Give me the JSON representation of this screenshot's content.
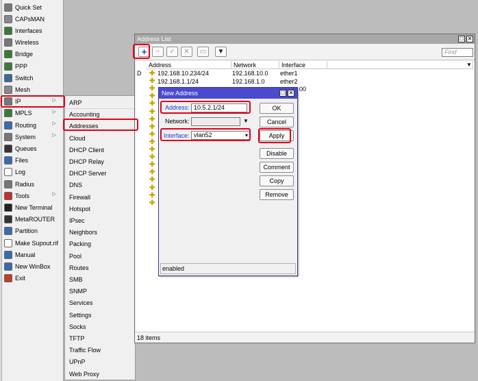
{
  "menu": [
    {
      "label": "Quick Set",
      "icon": "quick-set-icon",
      "color": "#777"
    },
    {
      "label": "CAPsMAN",
      "icon": "capsman-icon",
      "color": "#888"
    },
    {
      "label": "Interfaces",
      "icon": "interfaces-icon",
      "color": "#3a7a3a"
    },
    {
      "label": "Wireless",
      "icon": "wireless-icon",
      "color": "#777"
    },
    {
      "label": "Bridge",
      "icon": "bridge-icon",
      "color": "#3a7a3a"
    },
    {
      "label": "PPP",
      "icon": "ppp-icon",
      "color": "#3a7a3a"
    },
    {
      "label": "Switch",
      "icon": "switch-icon",
      "color": "#3a6a9a"
    },
    {
      "label": "Mesh",
      "icon": "mesh-icon",
      "color": "#888"
    },
    {
      "label": "IP",
      "icon": "ip-icon",
      "color": "#777",
      "arrow": true
    },
    {
      "label": "MPLS",
      "icon": "mpls-icon",
      "color": "#3a7a3a",
      "arrow": true
    },
    {
      "label": "Routing",
      "icon": "routing-icon",
      "color": "#3a6ab0",
      "arrow": true
    },
    {
      "label": "System",
      "icon": "system-icon",
      "color": "#777",
      "arrow": true
    },
    {
      "label": "Queues",
      "icon": "queues-icon",
      "color": "#333"
    },
    {
      "label": "Files",
      "icon": "files-icon",
      "color": "#3a6ab0"
    },
    {
      "label": "Log",
      "icon": "log-icon",
      "color": "#fff"
    },
    {
      "label": "Radius",
      "icon": "radius-icon",
      "color": "#777"
    },
    {
      "label": "Tools",
      "icon": "tools-icon",
      "color": "#c03030",
      "arrow": true
    },
    {
      "label": "New Terminal",
      "icon": "terminal-icon",
      "color": "#222"
    },
    {
      "label": "MetaROUTER",
      "icon": "metarouter-icon",
      "color": "#333"
    },
    {
      "label": "Partition",
      "icon": "partition-icon",
      "color": "#3a6ab0"
    },
    {
      "label": "Make Supout.rif",
      "icon": "supout-icon",
      "color": "#fff"
    },
    {
      "label": "Manual",
      "icon": "manual-icon",
      "color": "#3a6ab0"
    },
    {
      "label": "New WinBox",
      "icon": "winbox-icon",
      "color": "#3a6ab0"
    },
    {
      "label": "Exit",
      "icon": "exit-icon",
      "color": "#c04020"
    }
  ],
  "submenu": [
    "ARP",
    "Accounting",
    "Addresses",
    "Cloud",
    "DHCP Client",
    "DHCP Relay",
    "DHCP Server",
    "DNS",
    "Firewall",
    "Hotspot",
    "IPsec",
    "Neighbors",
    "Packing",
    "Pool",
    "Routes",
    "SMB",
    "SNMP",
    "Services",
    "Settings",
    "Socks",
    "TFTP",
    "Traffic Flow",
    "UPnP",
    "Web Proxy"
  ],
  "address_list": {
    "title": "Address List",
    "find_placeholder": "Find",
    "columns": [
      "Address",
      "Network",
      "Interface"
    ],
    "rows": [
      {
        "flag": "D",
        "address": "192.168.10.234/24",
        "network": "192.168.10.0",
        "interface": "ether1"
      },
      {
        "flag": "",
        "address": "192.168.1.1/24",
        "network": "192.168.1.0",
        "interface": "ether2"
      }
    ],
    "partial_interface": "00",
    "status": "18 items"
  },
  "dialog": {
    "title": "New Address",
    "address_label": "Address:",
    "address_value": "10.5.2.1/24",
    "network_label": "Network:",
    "interface_label": "Interface:",
    "interface_value": "vlan52",
    "buttons": {
      "ok": "OK",
      "cancel": "Cancel",
      "apply": "Apply",
      "disable": "Disable",
      "comment": "Comment",
      "copy": "Copy",
      "remove": "Remove"
    },
    "status": "enabled"
  },
  "colors": {
    "highlight": "#e2001a",
    "dialog_title": "#4a4acf",
    "label_blue": "#1a3ad0"
  }
}
